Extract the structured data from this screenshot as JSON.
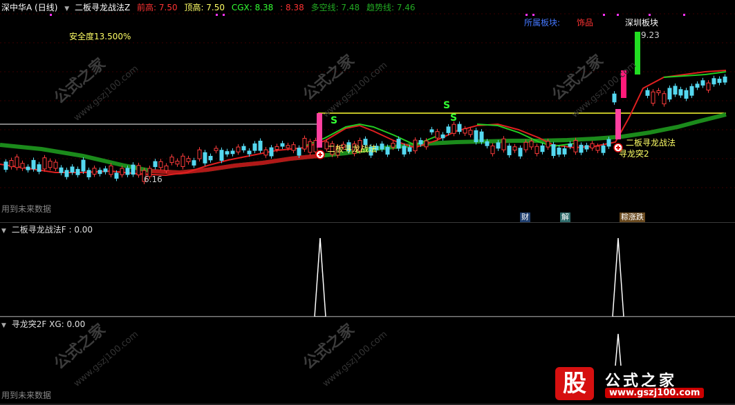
{
  "main": {
    "stock_name": "深中华A (日线)",
    "indicator_name": "二板寻龙战法Z",
    "items": [
      {
        "label": "前高: 7.50",
        "color": "#ff3333"
      },
      {
        "label": "顶高: 7.50",
        "color": "#ffff66"
      },
      {
        "label": "CGX: 8.38",
        "color": "#33ff33"
      },
      {
        "label": ": 8.38",
        "color": "#ff3333"
      },
      {
        "label": "多空线: 7.48",
        "color": "#22aa22"
      },
      {
        "label": "趋势线: 7.46",
        "color": "#22aa22"
      }
    ],
    "safety": "安全度13.500%",
    "future_note": "用到未来数据",
    "sector_label": "所属板块:",
    "sector_1": "饰品",
    "sector_2": "深圳板块",
    "high_price": "9.23",
    "low_price": "6.16",
    "signal_s": "S",
    "signal_1": "二板寻龙战法",
    "signal_2": "二板寻龙战法",
    "signal_3": "寻龙突2",
    "tag_cai": "财",
    "tag_jie": "解",
    "tag_combo": "粽涨跌"
  },
  "ind1": {
    "title": "二板寻龙战法F : 0.00"
  },
  "ind2": {
    "title": "寻龙突2F  XG: 0.00",
    "future_note": "用到未来数据"
  },
  "watermark": {
    "text": "公式之家",
    "url": "www.gszj100.com"
  },
  "logo": {
    "mark": "股",
    "name": "公式之家",
    "url": "www.gszj100.com"
  }
}
